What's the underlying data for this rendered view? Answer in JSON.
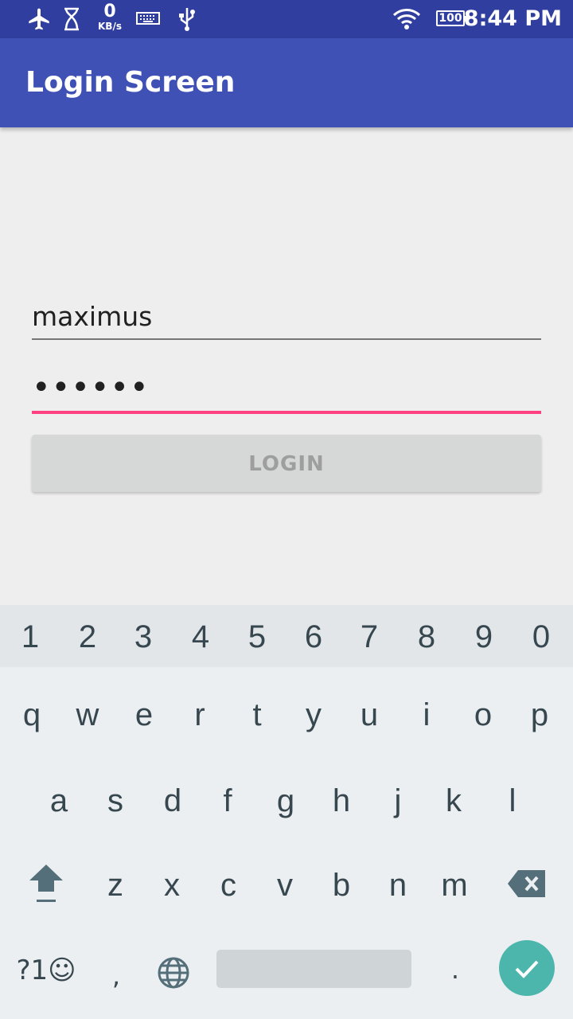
{
  "status_bar": {
    "icons": [
      "airplane-icon",
      "hourglass-icon",
      "keyboard-icon",
      "usb-icon",
      "wifi-icon"
    ],
    "net_speed_value": "0",
    "net_speed_unit": "KB/s",
    "battery_level": "100",
    "time": "8:44 PM"
  },
  "app_bar": {
    "title": "Login Screen",
    "color": "#3f51b5"
  },
  "form": {
    "username_value": "maximus",
    "password_value": "••••••",
    "login_label": "LOGIN",
    "accent_color": "#ff4081"
  },
  "keyboard": {
    "number_row": [
      "1",
      "2",
      "3",
      "4",
      "5",
      "6",
      "7",
      "8",
      "9",
      "0"
    ],
    "row1": [
      "q",
      "w",
      "e",
      "r",
      "t",
      "y",
      "u",
      "i",
      "o",
      "p"
    ],
    "row2": [
      "a",
      "s",
      "d",
      "f",
      "g",
      "h",
      "j",
      "k",
      "l"
    ],
    "row3": [
      "z",
      "x",
      "c",
      "v",
      "b",
      "n",
      "m"
    ],
    "symbols_label": "?1☺",
    "comma": ",",
    "period": ".",
    "enter_color": "#4db6ac"
  }
}
